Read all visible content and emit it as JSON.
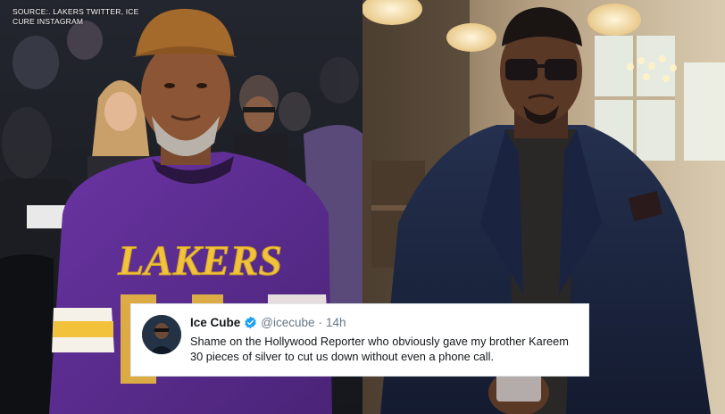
{
  "source_credit": "SOURCE:. LAKERS TWITTER, ICE CURE INSTAGRAM",
  "left_photo": {
    "jersey_text": "LAKERS",
    "colors": {
      "jersey": "#5b2c8f",
      "gold": "#f2c23a",
      "cap": "#a46a2c"
    }
  },
  "right_photo": {
    "colors": {
      "suit": "#1c2640",
      "shirt": "#2a2826",
      "wall": "#c9b596"
    }
  },
  "tweet": {
    "name": "Ice Cube",
    "handle": "@icecube",
    "separator": "·",
    "time": "14h",
    "text": "Shame on the Hollywood Reporter who obviously gave my brother Kareem 30 pieces of silver to cut us down without even a phone call.",
    "verified_color": "#1da1f2"
  }
}
